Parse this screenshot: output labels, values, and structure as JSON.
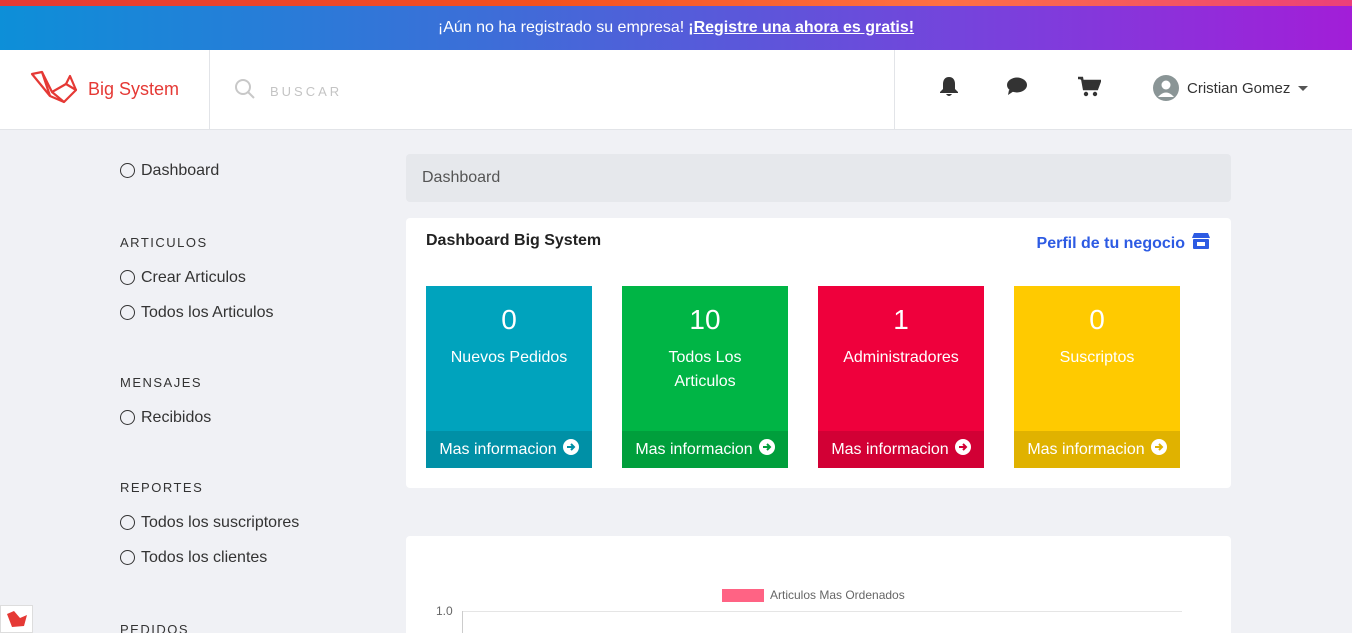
{
  "promo": {
    "text": "¡Aún no ha registrado su empresa!",
    "link": "¡Registre una ahora es gratis!"
  },
  "brand": {
    "name": "Big System",
    "icon": "laravel-logo-icon"
  },
  "search": {
    "placeholder": "BUSCAR",
    "icon": "search-icon"
  },
  "nav": {
    "icons": [
      "bell-icon",
      "chat-icon",
      "cart-icon"
    ],
    "user_name": "Cristian Gomez"
  },
  "sidebar": {
    "dashboard": "Dashboard",
    "sections": [
      {
        "heading": "ARTICULOS",
        "items": [
          "Crear Articulos",
          "Todos los Articulos"
        ]
      },
      {
        "heading": "MENSAJES",
        "items": [
          "Recibidos"
        ]
      },
      {
        "heading": "REPORTES",
        "items": [
          "Todos los suscriptores",
          "Todos los clientes"
        ]
      },
      {
        "heading": "PEDIDOS",
        "items": []
      }
    ]
  },
  "breadcrumb": "Dashboard",
  "card": {
    "title": "Dashboard Big System",
    "link": "Perfil de tu negocio"
  },
  "stats": [
    {
      "value": "0",
      "label": "Nuevos Pedidos",
      "footer": "Mas informacion",
      "color": "#00a3bd",
      "footer_color": "#0090a6"
    },
    {
      "value": "10",
      "label": "Todos Los Articulos",
      "footer": "Mas informacion",
      "color": "#00b545",
      "footer_color": "#009f3c"
    },
    {
      "value": "1",
      "label": "Administradores",
      "footer": "Mas informacion",
      "color": "#ef003c",
      "footer_color": "#d20035"
    },
    {
      "value": "0",
      "label": "Suscriptos",
      "footer": "Mas informacion",
      "color": "#ffca00",
      "footer_color": "#e0b200"
    }
  ],
  "chart_data": {
    "type": "bar",
    "series": [
      {
        "name": "Articulos Mas Ordenados",
        "values": []
      }
    ],
    "y_ticks": [
      "1.0"
    ],
    "legend_color": "#ff6384"
  }
}
